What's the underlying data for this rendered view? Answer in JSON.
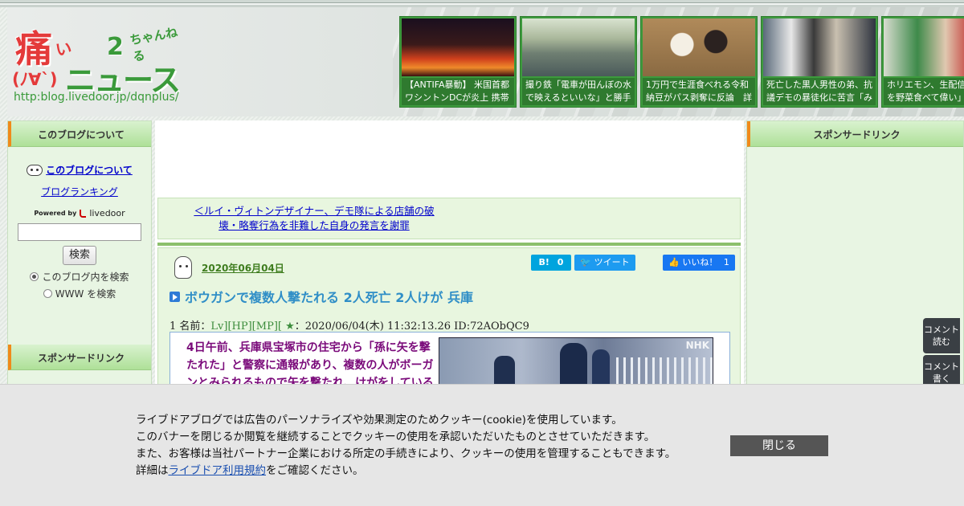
{
  "header": {
    "logo": {
      "main_kanji": "痛",
      "small_kana": "い",
      "ni": "2",
      "channel": "ちゃんねる",
      "face": "(ﾉ∀`)",
      "news": "ニュース",
      "url": "http:blog.livedoor.jp/dqnplus/"
    },
    "thumbnails": [
      {
        "caption": "【ANTIFA暴動】 米国首都ワシントンDCが炎上 携帯"
      },
      {
        "caption": "撮り鉄「電車が田んぼの水で映えるといいな」と勝手"
      },
      {
        "caption": "1万円で生涯食べれる令和納豆がパス剥奪に反論　詳"
      },
      {
        "caption": "死亡した黒人男性の弟、抗議デモの暴徒化に苦言「み"
      },
      {
        "caption": "ホリエモン、生配信で餃子を野菜食べて偉い」コメ"
      }
    ]
  },
  "left_sidebar": {
    "about_heading": "このブログについて",
    "about_link": "このブログについて",
    "ranking_link": "ブログランキング",
    "powered_by": "Powered by",
    "powered_brand": "livedoor",
    "search_value": "",
    "search_button": "検索",
    "radio_in_blog": "このブログ内を検索",
    "radio_www": "WWW を検索",
    "sponsor_heading": "スポンサードリンク"
  },
  "right_sidebar": {
    "sponsor_heading": "スポンサードリンク"
  },
  "article": {
    "prev_link": "＜ルイ・ヴィトンデザイナー、デモ隊による店舗の破壊・略奪行為を非難した自身の発言を謝罪",
    "date": "2020年06月04日",
    "hatena_label": "B!",
    "hatena_count": "0",
    "tweet_label": "ツイート",
    "like_label": "いいね！",
    "like_count": "1",
    "title": "ボウガンで複数人撃たれる 2人死亡 2人けが 兵庫",
    "meta_prefix": "1 名前：",
    "meta_name": "Lv][HP][MP][ ★",
    "meta_suffix": "：2020/06/04(木) 11:32:13.26 ID:72AObQC9",
    "quote_text": "4日午前、兵庫県宝塚市の住宅から「孫に矢を撃たれた」と警察に通報があり、複数の人がボーガンとみられるもので矢を撃たれ、けがをしている",
    "photo_watermark": "NHK"
  },
  "floating": {
    "read_comments": "コメント読む",
    "write_comments": "コメント書く"
  },
  "cookie": {
    "line1": "ライブドアブログでは広告のパーソナライズや効果測定のためクッキー(cookie)を使用しています。",
    "line2": "このバナーを閉じるか閲覧を継続することでクッキーの使用を承認いただいたものとさせていただきます。",
    "line3": "また、お客様は当社パートナー企業における所定の手続きにより、クッキーの使用を管理することもできます。",
    "line4_prefix": "詳細は",
    "line4_link": "ライブドア利用規約",
    "line4_suffix": "をご確認ください。",
    "close_button": "閉じる"
  },
  "colors": {
    "accent_green": "#3d9a3d",
    "orange_bar": "#f08a1a",
    "title_blue": "#2f8ec7",
    "quote_purple": "#7a0a7a"
  }
}
